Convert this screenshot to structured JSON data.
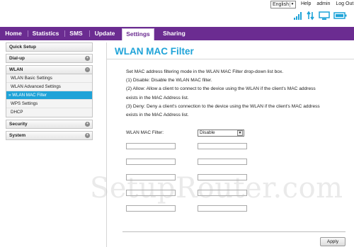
{
  "header": {
    "language": "English",
    "links": [
      "Help",
      "admin",
      "Log Out"
    ]
  },
  "status_icons": [
    "signal-icon",
    "data-transfer-icon",
    "pc-connection-icon",
    "battery-icon"
  ],
  "nav": {
    "items": [
      "Home",
      "Statistics",
      "SMS",
      "Update",
      "Settings",
      "Sharing"
    ],
    "active": "Settings"
  },
  "sidebar": {
    "quick_setup": "Quick Setup",
    "dialup": "Dial-up",
    "wlan": "WLAN",
    "wlan_items": [
      "WLAN Basic Settings",
      "WLAN Advanced Settings",
      "» WLAN MAC Filter",
      "WPS Settings",
      "DHCP"
    ],
    "security": "Security",
    "system": "System",
    "toggle_collapsed": "+",
    "toggle_expanded": "–"
  },
  "main": {
    "title": "WLAN MAC Filter",
    "description": [
      "Set MAC address filtering mode in the WLAN MAC Filter drop-down list box.",
      "(1) Disable: Disable the WLAN MAC filter.",
      "(2) Allow: Allow a client to connect to the device using the WLAN if the client's MAC address",
      "exists in the MAC Address list.",
      "(3) Deny: Deny a client's connection to the device using the WLAN if the client's MAC address",
      "exists in the MAC Address list."
    ],
    "filter_label": "WLAN MAC Filter:",
    "filter_value": "Disable",
    "mac_entries": [
      "",
      "",
      "",
      "",
      "",
      "",
      "",
      "",
      "",
      ""
    ],
    "apply_label": "Apply"
  },
  "watermark": "SetupRouter.com",
  "colors": {
    "nav_bg": "#6b2c91",
    "accent": "#1fa3d8"
  }
}
